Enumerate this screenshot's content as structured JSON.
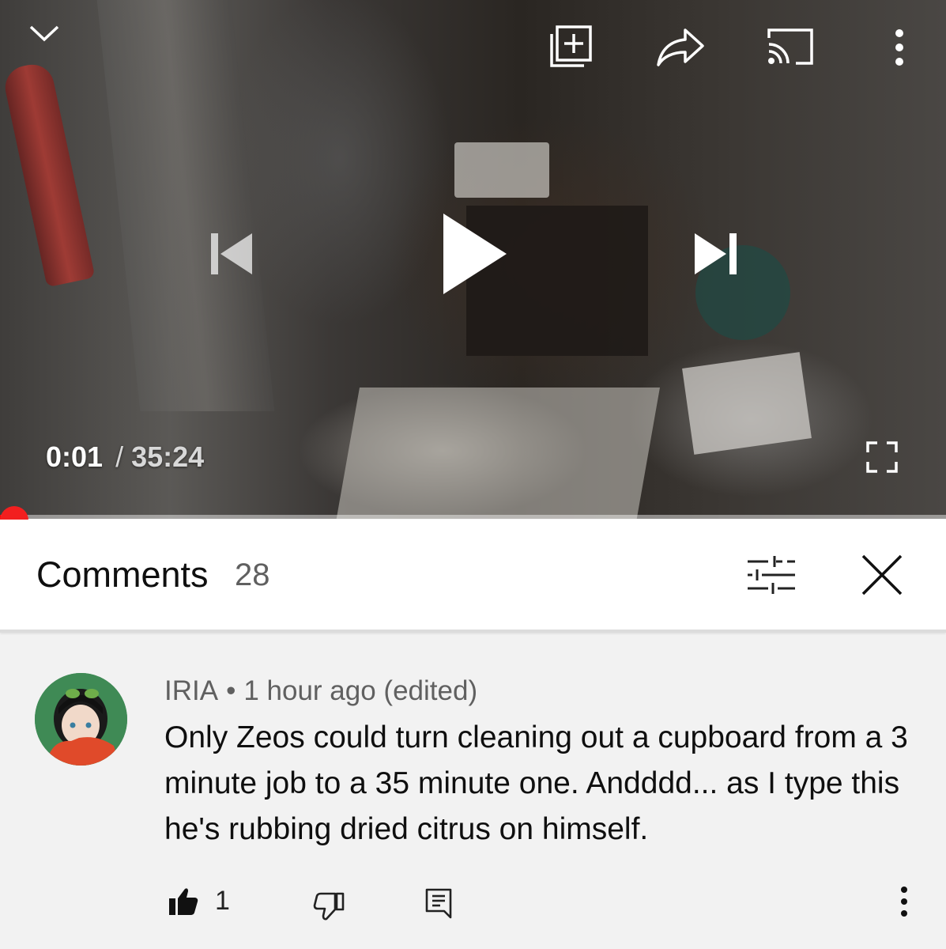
{
  "player": {
    "current_time": "0:01",
    "separator": "/",
    "duration": "35:24",
    "progress": 0.0005,
    "icons": {
      "minimize": "chevron-down-icon",
      "add_to_playlist": "add-to-playlist-icon",
      "share": "share-icon",
      "cast": "cast-icon",
      "more": "more-vert-icon",
      "previous": "skip-previous-icon",
      "play": "play-icon",
      "next": "skip-next-icon",
      "fullscreen": "fullscreen-icon"
    }
  },
  "comments_panel": {
    "title": "Comments",
    "count": "28",
    "icons": {
      "sort": "sort-filter-icon",
      "close": "close-icon"
    }
  },
  "comment": {
    "author": "IRIA",
    "separator": "•",
    "time": "1 hour ago (edited)",
    "text": "Only Zeos could turn cleaning out a cupboard from a 3 minute job to a 35 minute one. Andddd... as I type this he's rubbing dried citrus on himself.",
    "like_count": "1",
    "icons": {
      "like": "thumb-up-icon",
      "dislike": "thumb-down-icon",
      "reply": "reply-icon",
      "more": "more-vert-icon"
    }
  },
  "colors": {
    "progress_red": "#ff0000",
    "scrubber_red": "#f21f1f",
    "panel_bg": "#f2f2f2",
    "header_bg": "#ffffff"
  }
}
